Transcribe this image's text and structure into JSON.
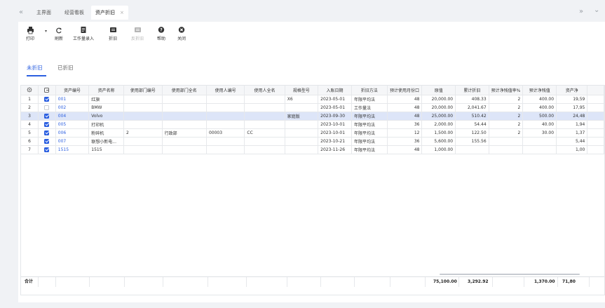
{
  "tabs": {
    "nav_left": "«",
    "nav_right": "»",
    "dropdown": "⌄",
    "items": [
      {
        "label": "主界面"
      },
      {
        "label": "经营看板"
      },
      {
        "label": "资产折旧",
        "close": "×"
      }
    ]
  },
  "toolbar": {
    "print": "打印",
    "caret": "▾",
    "refresh": "刷新",
    "workload": "工作量录入",
    "depreciate": "折旧",
    "reverse": "反折旧",
    "help": "帮助",
    "close": "关闭"
  },
  "subtabs": {
    "not_depreciated": "未折旧",
    "depreciated": "已折旧"
  },
  "table": {
    "columns": [
      "资产编号",
      "资产名称",
      "使用部门编号",
      "使用部门全名",
      "使用人编号",
      "使用人全名",
      "规格型号",
      "入账日期",
      "折旧方法",
      "预计使用月份口",
      "原值",
      "累计折旧",
      "预计净残值率%",
      "预计净残值",
      "资产净"
    ],
    "rows": [
      {
        "idx": "1",
        "checked": true,
        "code": "001",
        "name": "红旗",
        "dept_code": "",
        "dept_name": "",
        "user_code": "",
        "user_name": "",
        "spec": "X6",
        "date": "2023-05-01",
        "method": "年限平均法",
        "months": "48",
        "orig": "20,000.00",
        "accum": "408.33",
        "rate": "2",
        "residual": "400.00",
        "net": "19,59"
      },
      {
        "idx": "2",
        "checked": false,
        "code": "002",
        "name": "BMW",
        "dept_code": "",
        "dept_name": "",
        "user_code": "",
        "user_name": "",
        "spec": "",
        "date": "2023-05-01",
        "method": "工作量法",
        "months": "48",
        "orig": "20,000.00",
        "accum": "2,041.67",
        "rate": "2",
        "residual": "400.00",
        "net": "17,95"
      },
      {
        "idx": "3",
        "checked": true,
        "code": "004",
        "name": "Volvo",
        "dept_code": "",
        "dept_name": "",
        "user_code": "",
        "user_name": "",
        "spec": "家庭版",
        "date": "2023-09-30",
        "method": "年限平均法",
        "months": "48",
        "orig": "25,000.00",
        "accum": "510.42",
        "rate": "2",
        "residual": "500.00",
        "net": "24,48"
      },
      {
        "idx": "4",
        "checked": true,
        "code": "005",
        "name": "打印机",
        "dept_code": "",
        "dept_name": "",
        "user_code": "",
        "user_name": "",
        "spec": "",
        "date": "2023-10-01",
        "method": "年限平均法",
        "months": "36",
        "orig": "2,000.00",
        "accum": "54.44",
        "rate": "2",
        "residual": "40.00",
        "net": "1,94"
      },
      {
        "idx": "5",
        "checked": true,
        "code": "006",
        "name": "粉碎机",
        "dept_code": "2",
        "dept_name": "行政部",
        "user_code": "00003",
        "user_name": "CC",
        "spec": "",
        "date": "2023-10-01",
        "method": "年限平均法",
        "months": "12",
        "orig": "1,500.00",
        "accum": "122.50",
        "rate": "2",
        "residual": "30.00",
        "net": "1,37"
      },
      {
        "idx": "6",
        "checked": true,
        "code": "007",
        "name": "联想小新电...",
        "dept_code": "",
        "dept_name": "",
        "user_code": "",
        "user_name": "",
        "spec": "",
        "date": "2023-10-21",
        "method": "年限平均法",
        "months": "36",
        "orig": "5,600.00",
        "accum": "155.56",
        "rate": "",
        "residual": "",
        "net": "5,44"
      },
      {
        "idx": "7",
        "checked": true,
        "code": "1515",
        "name": "1515",
        "dept_code": "",
        "dept_name": "",
        "user_code": "",
        "user_name": "",
        "spec": "",
        "date": "2023-11-26",
        "method": "年限平均法",
        "months": "48",
        "orig": "1,000.00",
        "accum": "",
        "rate": "",
        "residual": "",
        "net": "1,00"
      }
    ],
    "footer": {
      "label": "合计",
      "orig": "75,100.00",
      "accum": "3,292.92",
      "residual": "1,370.00",
      "net": "71,80"
    }
  },
  "colors": {
    "accent": "#2b5fe0",
    "highlight_row": "#dde5f8"
  }
}
